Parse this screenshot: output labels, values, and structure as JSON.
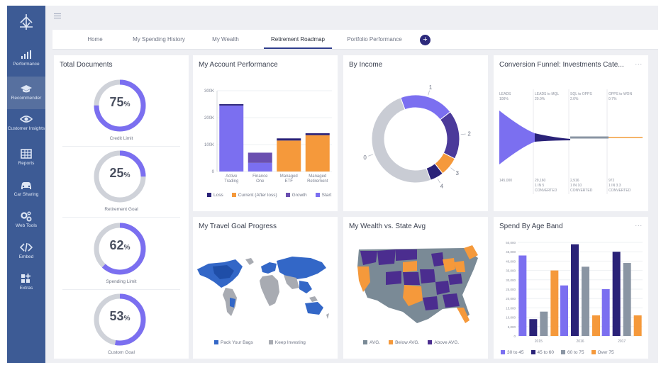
{
  "sidebar": {
    "items": [
      {
        "label": "Performance",
        "icon": "bar-chart-icon"
      },
      {
        "label": "Recommender",
        "icon": "graduation-cap-icon"
      },
      {
        "label": "Customer Insights",
        "icon": "eye-icon"
      },
      {
        "label": "Reports",
        "icon": "table-icon"
      },
      {
        "label": "Car Sharing",
        "icon": "car-icon"
      },
      {
        "label": "Web Tools",
        "icon": "gears-icon"
      },
      {
        "label": "Embed",
        "icon": "code-icon"
      },
      {
        "label": "Extras",
        "icon": "extras-icon"
      }
    ],
    "active_index": 1
  },
  "tabs": [
    "Home",
    "My Spending History",
    "My Wealth",
    "Retirement Roadmap",
    "Portfolio Performance"
  ],
  "active_tab": "Retirement Roadmap",
  "add_tab_label": "+",
  "colors": {
    "purple": "#7b6ff0",
    "navy": "#2a2278",
    "orange": "#f5993b",
    "gray": "#c9ccd4",
    "blue": "#3367c7",
    "state_gray": "#7a8a96",
    "state_purple": "#4b2d8f"
  },
  "total_documents": {
    "title": "Total Documents",
    "gauges": [
      {
        "value": 75,
        "pct": "%",
        "label": "Credit Limit"
      },
      {
        "value": 25,
        "pct": "%",
        "label": "Retirement Goal"
      },
      {
        "value": 62,
        "pct": "%",
        "label": "Spending Limit"
      },
      {
        "value": 53,
        "pct": "%",
        "label": "Custom Goal"
      }
    ]
  },
  "account_performance": {
    "title": "My Account Performance",
    "chart_data": {
      "type": "bar",
      "stacked": true,
      "categories": [
        "Active Trading",
        "Finance One",
        "Managed ETF",
        "Managed Retirement"
      ],
      "y_ticks": [
        "0",
        "100K",
        "200K",
        "300K"
      ],
      "ylim": [
        0,
        300000
      ],
      "series": [
        {
          "name": "Loss",
          "color": "#2a2278",
          "values": [
            5000,
            0,
            8000,
            7000
          ]
        },
        {
          "name": "Current (After loss)",
          "color": "#f5993b",
          "values": [
            0,
            0,
            115000,
            135000
          ]
        },
        {
          "name": "Growth",
          "color": "#6a4fb0",
          "values": [
            0,
            38000,
            0,
            0
          ]
        },
        {
          "name": "Start",
          "color": "#7b6ff0",
          "values": [
            245000,
            32000,
            0,
            0
          ]
        }
      ],
      "legend": [
        "Loss",
        "Current (After loss)",
        "Growth",
        "Start"
      ]
    }
  },
  "by_income": {
    "title": "By Income",
    "chart_data": {
      "type": "pie",
      "donut": true,
      "slices": [
        {
          "label": "0",
          "value": 50,
          "color": "#c9ccd4"
        },
        {
          "label": "1",
          "value": 20,
          "color": "#7b6ff0"
        },
        {
          "label": "2",
          "value": 18,
          "color": "#4b3a9a"
        },
        {
          "label": "3",
          "value": 7,
          "color": "#f5993b"
        },
        {
          "label": "4",
          "value": 5,
          "color": "#2a2278"
        }
      ]
    }
  },
  "funnel": {
    "title": "Conversion Funnel: Investments Cate...",
    "menu": "...",
    "stages": [
      {
        "top": "LEADS",
        "top_pct": "100%",
        "bottom": "145,000",
        "bottom2": "",
        "bottom3": ""
      },
      {
        "top": "LEADS to MQL",
        "top_pct": "20.0%",
        "bottom": "29,160",
        "bottom2": "1 IN 5",
        "bottom3": "CONVERTED"
      },
      {
        "top": "SQL to OPPS",
        "top_pct": "2.0%",
        "bottom": "2,916",
        "bottom2": "1 IN 10",
        "bottom3": "CONVERTED"
      },
      {
        "top": "OPPS to WON",
        "top_pct": "0.7%",
        "bottom": "972",
        "bottom2": "1 IN 3.3",
        "bottom3": "CONVERTED"
      }
    ]
  },
  "travel": {
    "title": "My Travel Goal Progress",
    "legend": [
      {
        "name": "Pack Your Bags",
        "color": "#3367c7"
      },
      {
        "name": "Keep Investing",
        "color": "#a8abb2"
      }
    ]
  },
  "wealth_state": {
    "title": "My Wealth vs. State Avg",
    "legend": [
      {
        "name": "AVG.",
        "color": "#7a8a96"
      },
      {
        "name": "Below AVG.",
        "color": "#f5993b"
      },
      {
        "name": "Above AVG.",
        "color": "#4b2d8f"
      }
    ]
  },
  "spend_age": {
    "title": "Spend By Age Band",
    "menu": "...",
    "chart_data": {
      "type": "bar",
      "categories": [
        "2015",
        "2016",
        "2017"
      ],
      "y_ticks": [
        "0",
        "5,000",
        "10,000",
        "15,000",
        "20,000",
        "25,000",
        "30,000",
        "35,000",
        "40,000",
        "45,000",
        "50,000"
      ],
      "ylim": [
        0,
        50000
      ],
      "series": [
        {
          "name": "30 to 45",
          "color": "#7b6ff0",
          "values": [
            43000,
            27000,
            25000
          ]
        },
        {
          "name": "45 to 60",
          "color": "#2a2278",
          "values": [
            9000,
            49000,
            45000
          ]
        },
        {
          "name": "60 to 75",
          "color": "#8a95a3",
          "values": [
            13000,
            37000,
            39000
          ]
        },
        {
          "name": "Over 75",
          "color": "#f5993b",
          "values": [
            35000,
            11000,
            11000
          ]
        }
      ]
    }
  }
}
